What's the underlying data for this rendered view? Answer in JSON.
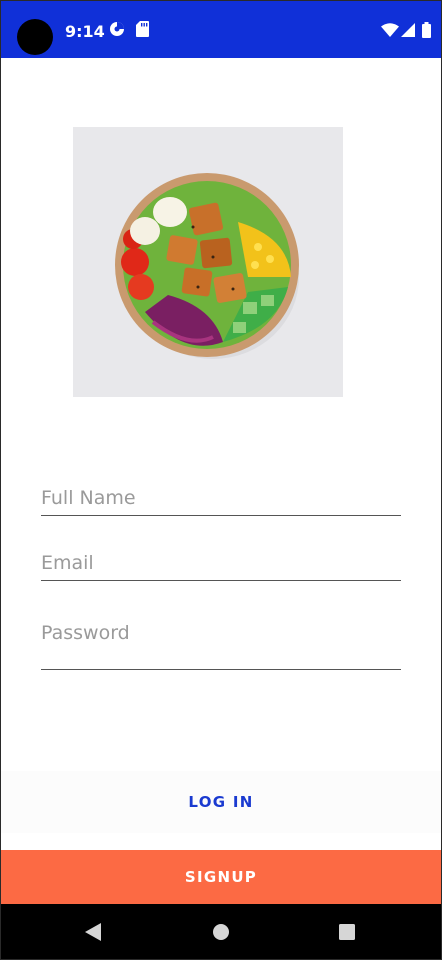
{
  "status_bar": {
    "time": "9:14",
    "background_color": "#1030d8",
    "left_icons": [
      "camera-dot-icon",
      "data-saver-icon",
      "sd-card-icon"
    ],
    "right_icons": [
      "wifi-icon",
      "cellular-signal-icon",
      "battery-icon"
    ]
  },
  "hero": {
    "image": "salad-bowl-photo"
  },
  "form": {
    "full_name": {
      "placeholder": "Full Name",
      "value": ""
    },
    "email": {
      "placeholder": "Email",
      "value": ""
    },
    "password": {
      "placeholder": "Password",
      "value": ""
    }
  },
  "actions": {
    "login_label": "LOG IN",
    "signup_label": "SIGNUP",
    "login_color": "#1a3ad0",
    "signup_color": "#fc6a44"
  },
  "nav_bar": {
    "buttons": [
      "back-icon",
      "home-icon",
      "recents-icon"
    ]
  }
}
